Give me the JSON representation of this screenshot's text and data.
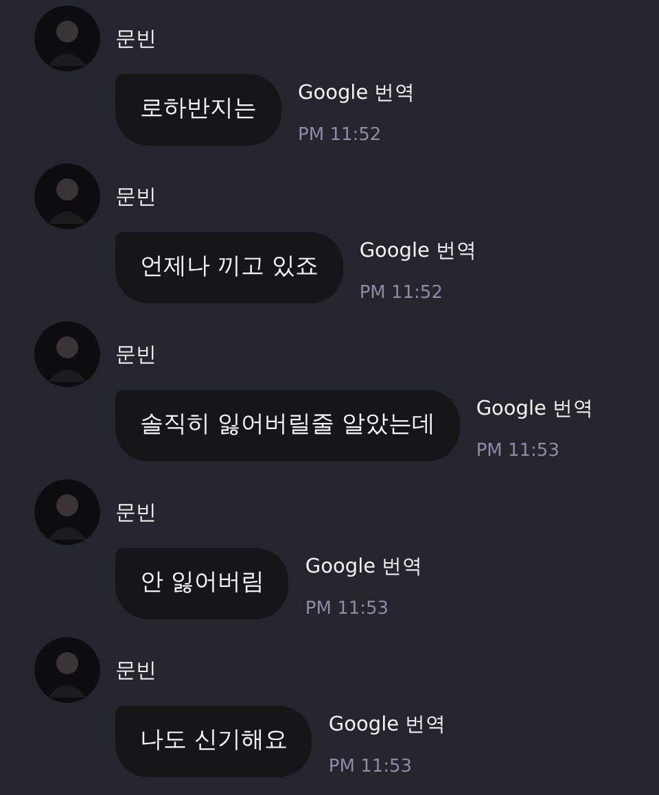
{
  "messages": [
    {
      "sender": "문빈",
      "text": "로하반지는",
      "translate_label": "Google 번역",
      "time": "PM 11:52"
    },
    {
      "sender": "문빈",
      "text": "언제나 끼고 있죠",
      "translate_label": "Google 번역",
      "time": "PM 11:52"
    },
    {
      "sender": "문빈",
      "text": "솔직히 잃어버릴줄 알았는데",
      "translate_label": "Google 번역",
      "time": "PM 11:53"
    },
    {
      "sender": "문빈",
      "text": "안 잃어버림",
      "translate_label": "Google 번역",
      "time": "PM 11:53"
    },
    {
      "sender": "문빈",
      "text": "나도 신기해요",
      "translate_label": "Google 번역",
      "time": "PM 11:53"
    }
  ]
}
